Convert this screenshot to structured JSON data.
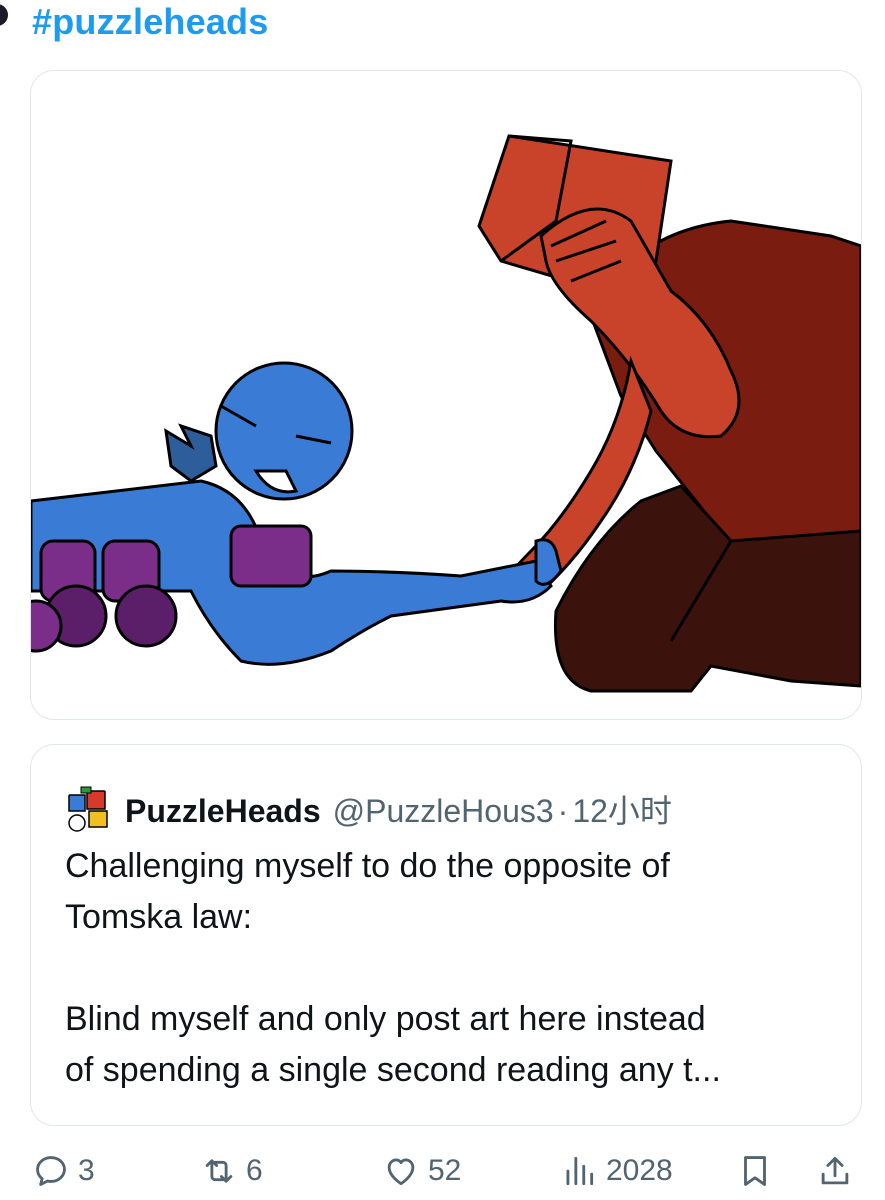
{
  "hashtag": "#puzzleheads",
  "media": {
    "alt_icon": "illustration"
  },
  "quote": {
    "display_name": "PuzzleHeads",
    "handle": "@PuzzleHous3",
    "separator": "·",
    "time": "12小时",
    "text_line1": "Challenging myself to do the opposite of",
    "text_line2": "Tomska law:",
    "text_line3": "Blind myself and only post art here instead",
    "text_line4": "of spending a single second reading any t..."
  },
  "actions": {
    "reply_count": "3",
    "repost_count": "6",
    "like_count": "52",
    "views_count": "2028"
  },
  "icons": {
    "reply": "reply-icon",
    "repost": "repost-icon",
    "like": "heart-icon",
    "views": "views-icon",
    "bookmark": "bookmark-icon",
    "share": "share-icon"
  },
  "colors": {
    "accent": "#1d9bf0",
    "muted": "#536471",
    "border": "#e1e6ea"
  }
}
